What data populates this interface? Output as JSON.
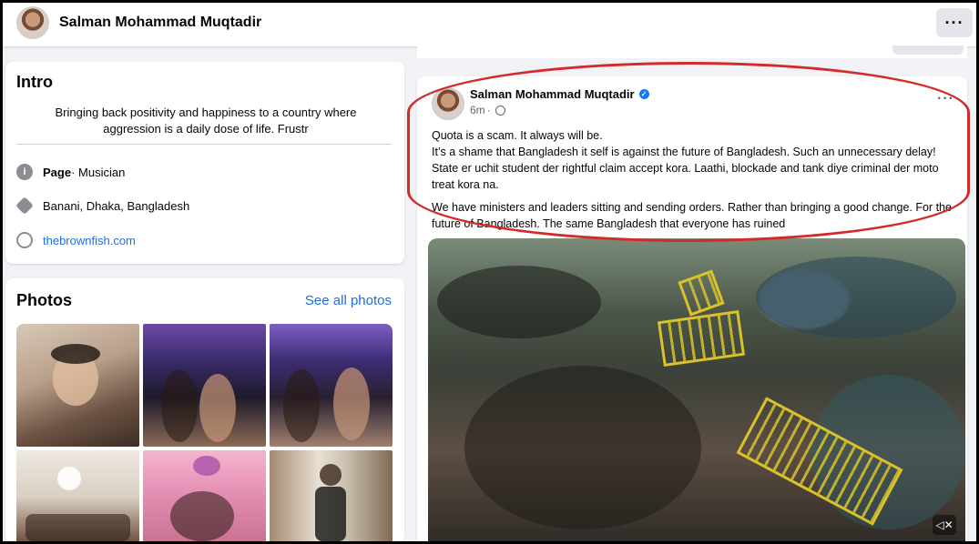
{
  "header": {
    "profile_name": "Salman Mohammad Muqtadir",
    "more_label": "···"
  },
  "intro": {
    "title": "Intro",
    "bio": "Bringing back positivity and happiness to a country where aggression is a daily dose of life. Frustr",
    "page_label": "Page",
    "page_category": " · Musician",
    "location": "Banani, Dhaka, Bangladesh",
    "website": "thebrownfish.com"
  },
  "photos": {
    "title": "Photos",
    "see_all": "See all photos"
  },
  "post": {
    "author": "Salman Mohammad Muqtadir",
    "time": "6m",
    "more_label": "···",
    "paragraph_1": "Quota is a scam. It always will be.",
    "paragraph_2": "It’s a shame that Bangladesh it self is against the future of Bangladesh. Such an unnecessary delay! State er uchit student der rightful claim accept kora. Laathi, blockade and tank diye criminal der moto treat kora na.",
    "paragraph_3": "We have ministers and leaders sitting and sending orders. Rather than bringing a good change. For the future of Bangladesh. The same Bangladesh that everyone has ruined"
  },
  "icons": {
    "info": "info-icon",
    "location": "location-icon",
    "website": "globe-icon",
    "audience": "globe-icon",
    "verified": "verified-badge-icon",
    "mute": "mute-icon"
  },
  "colors": {
    "link": "#216fdb",
    "annotation": "#d32a2a",
    "verified": "#1877f2"
  }
}
